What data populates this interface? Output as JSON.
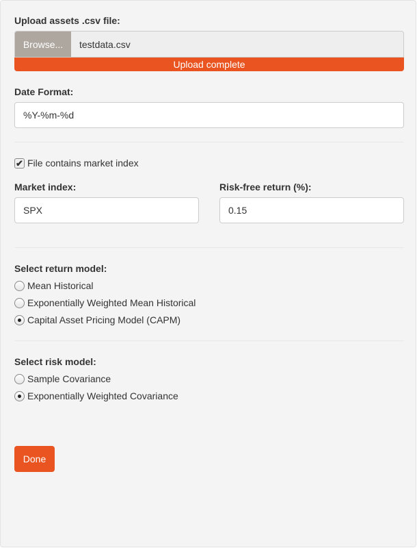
{
  "upload": {
    "label": "Upload assets .csv file:",
    "browse_label": "Browse...",
    "filename": "testdata.csv",
    "progress_text": "Upload complete",
    "progress": 100
  },
  "date_format": {
    "label": "Date Format:",
    "value": "%Y-%m-%d"
  },
  "market_checkbox": {
    "label": "File contains market index",
    "checked": true
  },
  "market_index": {
    "label": "Market index:",
    "value": "SPX"
  },
  "risk_free": {
    "label": "Risk-free return (%):",
    "value": "0.15"
  },
  "return_model": {
    "label": "Select return model:",
    "options": [
      "Mean Historical",
      "Exponentially Weighted Mean Historical",
      "Capital Asset Pricing Model (CAPM)"
    ],
    "selected": 2
  },
  "risk_model": {
    "label": "Select risk model:",
    "options": [
      "Sample Covariance",
      "Exponentially Weighted Covariance"
    ],
    "selected": 1
  },
  "done_label": "Done",
  "colors": {
    "accent": "#e95420",
    "browse": "#aea79f"
  }
}
